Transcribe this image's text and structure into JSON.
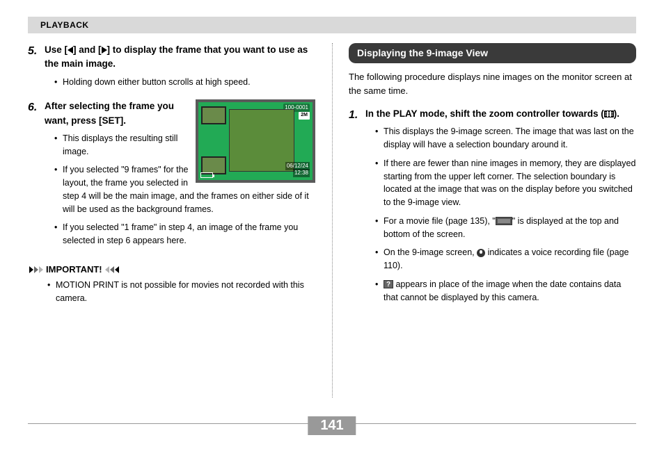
{
  "header": {
    "section": "PLAYBACK"
  },
  "left": {
    "step5": {
      "num": "5.",
      "title_pre": "Use [",
      "title_mid": "] and [",
      "title_post": "] to display the frame that you want to use as the main image.",
      "bullets": [
        "Holding down either button scrolls at high speed."
      ]
    },
    "step6": {
      "num": "6.",
      "title": "After selecting the frame you want, press [SET].",
      "bullets": [
        "This displays the resulting still image.",
        "If you selected \"9 frames\" for the layout, the frame you selected in step 4 will be the main image, and the frames on either side of it will be used as the background frames.",
        "If you selected \"1 frame\" in step 4, an image of the frame you selected in step 6 appears here."
      ]
    },
    "important": {
      "label": "IMPORTANT!",
      "bullets": [
        "MOTION PRINT is not possible for movies not recorded with this camera."
      ]
    },
    "lcd": {
      "file_no": "100-0001",
      "size": "2M",
      "date": "06/12/24",
      "time": "12:38"
    }
  },
  "right": {
    "section_title": "Displaying the 9-image View",
    "intro": "The following procedure displays nine images on the monitor screen at the same time.",
    "step1": {
      "num": "1.",
      "title_pre": "In the PLAY mode, shift the zoom controller towards (",
      "title_post": ").",
      "bullets": [
        {
          "text": "This displays the 9-image screen. The image that was last on the display will have a selection boundary around it."
        },
        {
          "text": "If there are fewer than nine images in memory, they are displayed starting from the upper left corner. The selection boundary is located at the image that was on the display before you switched to the 9-image view."
        },
        {
          "pre": "For a movie file (page 135), \"",
          "icon": "filmstrip",
          "post": "\" is displayed at the top and bottom of the screen."
        },
        {
          "pre": "On the 9-image screen, ",
          "icon": "mic",
          "post": " indicates a voice recording file (page 110)."
        },
        {
          "icon": "question",
          "post": " appears in place of the image when the date contains data that cannot be displayed by this camera."
        }
      ]
    }
  },
  "page_number": "141"
}
